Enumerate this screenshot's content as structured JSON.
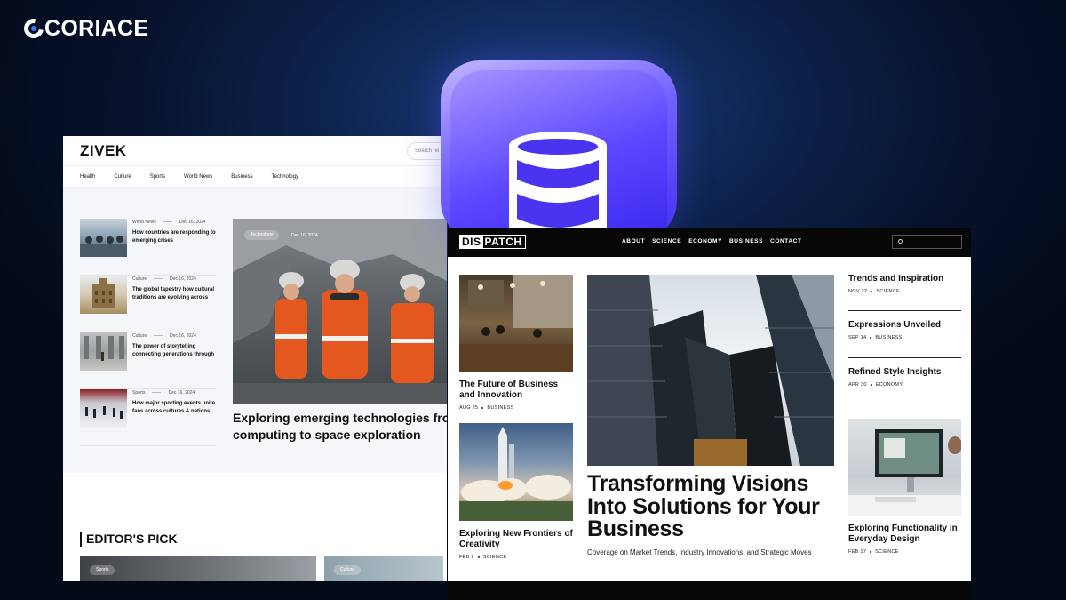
{
  "brand": {
    "name": "CORIACE"
  },
  "zivek": {
    "logo": "ZIVEK",
    "search_placeholder": "Search he",
    "nav": [
      "Health",
      "Culture",
      "Sports",
      "World News",
      "Business",
      "Technology"
    ],
    "list": [
      {
        "category": "World News",
        "date": "Dec 16, 2024",
        "title": "How countries are responding to emerging crises"
      },
      {
        "category": "Culture",
        "date": "Dec 16, 2024",
        "title": "The global tapestry how cultural traditions are evolving across"
      },
      {
        "category": "Culture",
        "date": "Dec 16, 2024",
        "title": "The power of storytelling connecting generations through"
      },
      {
        "category": "Sports",
        "date": "Dec 16, 2024",
        "title": "How major sporting events unite fans across cultures & nations"
      }
    ],
    "hero": {
      "category": "Technology",
      "date": "Dec 16, 2024",
      "title": "Exploring emerging technologies from computing to space exploration"
    },
    "editors_pick": {
      "heading": "EDITOR'S PICK",
      "card1_tag": "Sports",
      "card2_tag": "Culture"
    }
  },
  "dispatch": {
    "logo_a": "DIS",
    "logo_b": "PATCH",
    "nav": [
      "ABOUT",
      "SCIENCE",
      "ECONOMY",
      "BUSINESS",
      "CONTACT"
    ],
    "left": [
      {
        "title": "The Future of Business and Innovation",
        "date": "AUG 25",
        "tag": "BUSINESS"
      },
      {
        "title": "Exploring New Frontiers of Creativity",
        "date": "FEB 2",
        "tag": "SCIENCE"
      }
    ],
    "headline": "Transforming Visions Into Solutions for Your Business",
    "subline": "Coverage on Market Trends, Industry Innovations, and Strategic Moves",
    "right": [
      {
        "title": "Trends and Inspiration",
        "date": "NOV 22",
        "tag": "SCIENCE"
      },
      {
        "title": "Expressions Unveiled",
        "date": "SEP 14",
        "tag": "BUSINESS"
      },
      {
        "title": "Refined Style Insights",
        "date": "APR 30",
        "tag": "ECONOMY"
      },
      {
        "title": "Exploring Functionality in Everyday Design",
        "date": "FEB 17",
        "tag": "SCIENCE"
      }
    ]
  },
  "colors": {
    "accent": "#4630f2",
    "background": "#06112a"
  }
}
